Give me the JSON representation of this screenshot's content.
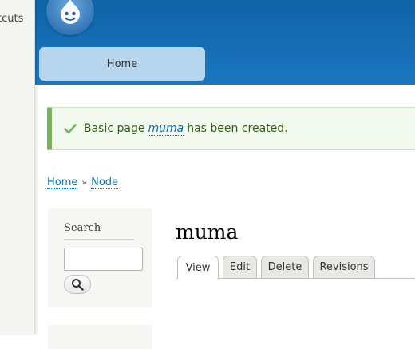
{
  "toolbar": {
    "shortcuts_label": "tcuts"
  },
  "header": {
    "logo_icon": "drupal-drop-logo",
    "primary_tabs": [
      {
        "label": "Home"
      }
    ],
    "colors": {
      "header_bg": "#1a77c0",
      "tab_bg": "#b7d5ec"
    }
  },
  "status": {
    "icon": "check-icon",
    "prefix": "Basic page",
    "link_text": "muma",
    "suffix": "has been created.",
    "colors": {
      "text": "#325e1c",
      "accent": "#77b259"
    }
  },
  "breadcrumb": {
    "items": [
      {
        "label": "Home"
      },
      {
        "label": "Node"
      }
    ],
    "separator": "»"
  },
  "sidebar": {
    "search": {
      "title": "Search",
      "input_value": "",
      "button_icon": "search-icon"
    }
  },
  "main": {
    "title": "muma",
    "tabs": [
      {
        "label": "View",
        "active": true
      },
      {
        "label": "Edit",
        "active": false
      },
      {
        "label": "Delete",
        "active": false
      },
      {
        "label": "Revisions",
        "active": false
      }
    ]
  }
}
